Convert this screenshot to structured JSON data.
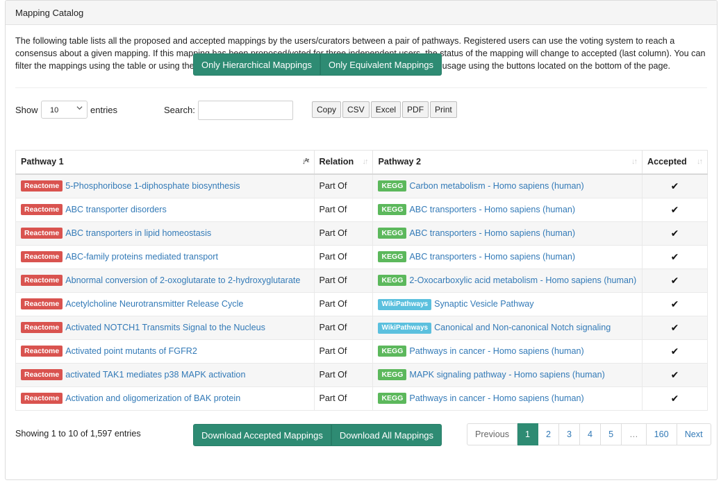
{
  "panel": {
    "title": "Mapping Catalog"
  },
  "intro": "The following table lists all the proposed and accepted mappings by the users/curators between a pair of pathways. Registered users can use the voting system to reach a consensus about a given mapping. If this mapping has been proposed/voted for three independent users, the status of the mapping will change to accepted (last column). You can filter the mappings using the table or using the buttons below. Mappings can be downloaded for programmatic usage using the buttons located on the bottom of the page.",
  "filter_buttons": {
    "hierarchical": "Only Hierarchical Mappings",
    "equivalent": "Only Equivalent Mappings"
  },
  "controls": {
    "show_label": "Show",
    "length_value": "10",
    "entries_label": "entries",
    "search_label": "Search:",
    "search_value": "",
    "export": {
      "copy": "Copy",
      "csv": "CSV",
      "excel": "Excel",
      "pdf": "PDF",
      "print": "Print"
    }
  },
  "table": {
    "headers": {
      "pathway1": "Pathway 1",
      "relation": "Relation",
      "pathway2": "Pathway 2",
      "accepted": "Accepted"
    },
    "rows": [
      {
        "db1": "Reactome",
        "p1": "5-Phosphoribose 1-diphosphate biosynthesis",
        "rel": "Part Of",
        "db2": "KEGG",
        "p2": "Carbon metabolism - Homo sapiens (human)",
        "acc": "✔"
      },
      {
        "db1": "Reactome",
        "p1": "ABC transporter disorders",
        "rel": "Part Of",
        "db2": "KEGG",
        "p2": "ABC transporters - Homo sapiens (human)",
        "acc": "✔"
      },
      {
        "db1": "Reactome",
        "p1": "ABC transporters in lipid homeostasis",
        "rel": "Part Of",
        "db2": "KEGG",
        "p2": "ABC transporters - Homo sapiens (human)",
        "acc": "✔"
      },
      {
        "db1": "Reactome",
        "p1": "ABC-family proteins mediated transport",
        "rel": "Part Of",
        "db2": "KEGG",
        "p2": "ABC transporters - Homo sapiens (human)",
        "acc": "✔"
      },
      {
        "db1": "Reactome",
        "p1": "Abnormal conversion of 2-oxoglutarate to 2-hydroxyglutarate",
        "rel": "Part Of",
        "db2": "KEGG",
        "p2": "2-Oxocarboxylic acid metabolism - Homo sapiens (human)",
        "acc": "✔"
      },
      {
        "db1": "Reactome",
        "p1": "Acetylcholine Neurotransmitter Release Cycle",
        "rel": "Part Of",
        "db2": "WikiPathways",
        "p2": "Synaptic Vesicle Pathway",
        "acc": "✔"
      },
      {
        "db1": "Reactome",
        "p1": "Activated NOTCH1 Transmits Signal to the Nucleus",
        "rel": "Part Of",
        "db2": "WikiPathways",
        "p2": "Canonical and Non-canonical Notch signaling",
        "acc": "✔"
      },
      {
        "db1": "Reactome",
        "p1": "Activated point mutants of FGFR2",
        "rel": "Part Of",
        "db2": "KEGG",
        "p2": "Pathways in cancer - Homo sapiens (human)",
        "acc": "✔"
      },
      {
        "db1": "Reactome",
        "p1": "activated TAK1 mediates p38 MAPK activation",
        "rel": "Part Of",
        "db2": "KEGG",
        "p2": "MAPK signaling pathway - Homo sapiens (human)",
        "acc": "✔"
      },
      {
        "db1": "Reactome",
        "p1": "Activation and oligomerization of BAK protein",
        "rel": "Part Of",
        "db2": "KEGG",
        "p2": "Pathways in cancer - Homo sapiens (human)",
        "acc": "✔"
      }
    ]
  },
  "info": "Showing 1 to 10 of 1,597 entries",
  "pagination": {
    "previous": "Previous",
    "pages": [
      "1",
      "2",
      "3",
      "4",
      "5"
    ],
    "ellipsis": "…",
    "last": "160",
    "next": "Next"
  },
  "download_buttons": {
    "accepted": "Download Accepted Mappings",
    "all": "Download All Mappings"
  },
  "colors": {
    "accent": "#2e8b73",
    "reactome": "#d9534f",
    "kegg": "#5cb85c",
    "wikipathways": "#5bc0de",
    "link": "#337ab7"
  },
  "icons": {
    "sort_active": "sort-alpha-asc-icon",
    "sort": "sort-icon",
    "check": "check-icon",
    "dropdown": "chevron-down-icon"
  }
}
